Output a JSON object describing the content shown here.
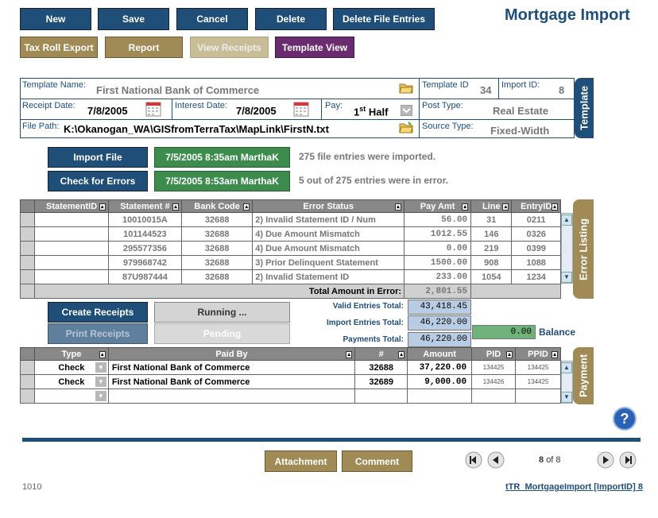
{
  "toolbar": {
    "new": "New",
    "save": "Save",
    "cancel": "Cancel",
    "delete": "Delete",
    "delete_file_entries": "Delete File Entries"
  },
  "page_title": "Mortgage Import",
  "secondary_buttons": {
    "tax_roll_export": "Tax Roll Export",
    "report": "Report",
    "view_receipts": "View Receipts",
    "template_view": "Template View"
  },
  "template_panel": {
    "side_label": "Template",
    "template_name_label": "Template Name:",
    "template_name": "First National Bank of Commerce",
    "template_id_label": "Template ID",
    "template_id": "34",
    "import_id_label": "Import ID:",
    "import_id": "8",
    "receipt_date_label": "Receipt Date:",
    "receipt_date": "7/8/2005",
    "interest_date_label": "Interest Date:",
    "interest_date": "7/8/2005",
    "pay_label": "Pay:",
    "pay_num": "1",
    "pay_sup": "st",
    "pay_half": "Half",
    "post_type_label": "Post Type:",
    "post_type": "Real Estate",
    "file_path_label": "File Path:",
    "file_path": "K:\\Okanogan_WA\\GISfromTerraTax\\MapLink\\FirstN.txt",
    "source_type_label": "Source Type:",
    "source_type": "Fixed-Width"
  },
  "import": {
    "import_file": "Import File",
    "import_stamp": "7/5/2005 8:35am MarthaK",
    "import_msg": "275 file entries were imported.",
    "check_errors": "Check for Errors",
    "check_stamp": "7/5/2005 8:53am MarthaK",
    "check_msg": "5 out of 275 entries were in error."
  },
  "errors": {
    "side_label": "Error Listing",
    "columns": [
      "StatementID",
      "Statement #",
      "Bank Code",
      "Error Status",
      "Pay Amt",
      "Line",
      "EntryID"
    ],
    "rows": [
      [
        "",
        "10010015A",
        "32688",
        "2) Invalid Statement ID / Num",
        "56.00",
        "31",
        "0211"
      ],
      [
        "",
        "101144523",
        "32688",
        "4) Due Amount Mismatch",
        "1012.55",
        "146",
        "0326"
      ],
      [
        "",
        "295577356",
        "32688",
        "4) Due Amount Mismatch",
        "0.00",
        "219",
        "0399"
      ],
      [
        "",
        "979968742",
        "32688",
        "3) Prior Delinquent Statement",
        "1500.00",
        "908",
        "1088"
      ],
      [
        "",
        "87U987444",
        "32688",
        "2) Invalid Statement ID",
        "233.00",
        "1054",
        "1234"
      ]
    ],
    "total_label": "Total Amount in Error:",
    "total": "2,801.55"
  },
  "receipts": {
    "create": "Create Receipts",
    "running": "Running ...",
    "print": "Print Receipts",
    "pending": "Pending",
    "valid_label": "Valid Entries Total:",
    "valid": "43,418.45",
    "import_label": "Import Entries Total:",
    "import": "46,220.00",
    "payments_label": "Payments Total:",
    "payments": "46,220.00",
    "balance": "0.00",
    "balance_label": "Balance"
  },
  "payment": {
    "side_label": "Payment",
    "columns": [
      "Type",
      "Paid By",
      "#",
      "Amount",
      "PID",
      "PPID"
    ],
    "rows": [
      [
        "Check",
        "First National Bank of Commerce",
        "32688",
        "37,220.00",
        "134425",
        "134425"
      ],
      [
        "Check",
        "First National Bank of Commerce",
        "32689",
        "9,000.00",
        "134426",
        "134425"
      ]
    ]
  },
  "footer": {
    "attachment": "Attachment",
    "comment": "Comment",
    "page_current": "8",
    "page_of": "of 8",
    "left_code": "1010",
    "right_link": "tTR_MortgageImport [ImportID] 8"
  },
  "help_icon": "question-icon"
}
